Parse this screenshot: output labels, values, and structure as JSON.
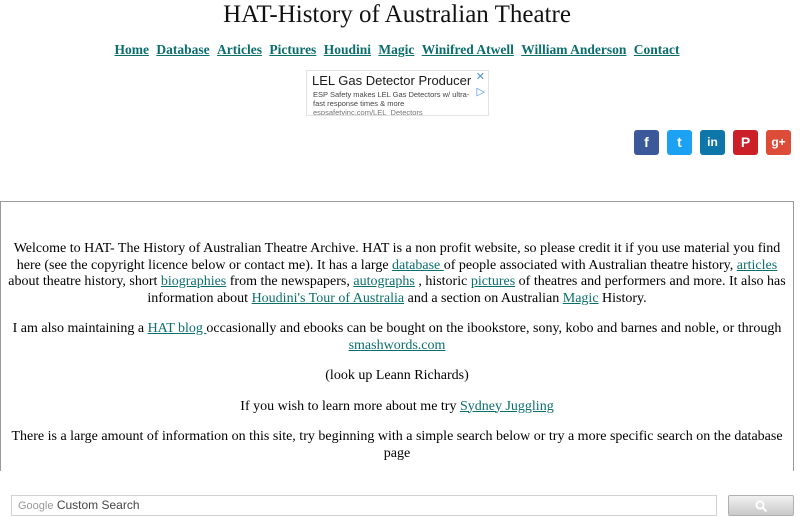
{
  "header": {
    "title": "HAT-History of Australian Theatre"
  },
  "nav": [
    "Home",
    "Database",
    "Articles",
    "Pictures",
    "Houdini",
    "Magic",
    "Winifred Atwell",
    "William Anderson",
    "Contact"
  ],
  "ad": {
    "headline": "LEL Gas Detector Producer",
    "description": "ESP Safety makes LEL Gas Detectors w/ ultra-fast response times & more",
    "url": "espsafetyinc.com/LEL_Detectors"
  },
  "social": {
    "facebook": "f",
    "twitter": "t",
    "linkedin": "in",
    "pinterest": "P",
    "googleplus": "g+",
    "icons": [
      "facebook-icon",
      "twitter-icon",
      "linkedin-icon",
      "pinterest-icon",
      "google-plus-icon"
    ],
    "colors": {
      "facebook": "#3b5998",
      "twitter": "#1da1f2",
      "linkedin": "#0e76a8",
      "pinterest": "#cb2027",
      "googleplus": "#dd4b39"
    }
  },
  "content": {
    "p1": {
      "t1": "Welcome to HAT- The History of Australian Theatre Archive. HAT is a non profit website, so please credit it if you use material you find here (see the copyright licence below or contact me). It has a large ",
      "link_database": "database ",
      "t2": " of people associated with  Australian theatre history, ",
      "link_articles": "articles",
      "t3": " about theatre history, short ",
      "link_biographies": "biographies",
      "t4": " from the newspapers, ",
      "link_autographs": "autographs",
      "t5": " , historic ",
      "link_pictures": "pictures",
      "t6": " of theatres and performers and more. It also has information about ",
      "link_houdini": "Houdini's Tour of Australia",
      "t7": " and a section on Australian ",
      "link_magic": "Magic",
      "t8": " History."
    },
    "p2": {
      "t1": "I am also maintaining a  ",
      "link_blog": "HAT blog ",
      "t2": " occasionally and ebooks can be bought on the ibookstore,  sony, kobo and barnes and noble, or through ",
      "link_smashwords": "smashwords.com"
    },
    "p3": "(look up Leann Richards)",
    "p4": {
      "t1": "If you wish to learn more about me try ",
      "link_juggling": "Sydney Juggling"
    },
    "p5": "There is a large amount of information on this site, try beginning with a simple search below or try a more specific search on the database page"
  },
  "search": {
    "brand": "Google",
    "placeholder": "Custom Search",
    "button_icon": "search-icon"
  },
  "colors": {
    "link": "#0b6e6e"
  }
}
